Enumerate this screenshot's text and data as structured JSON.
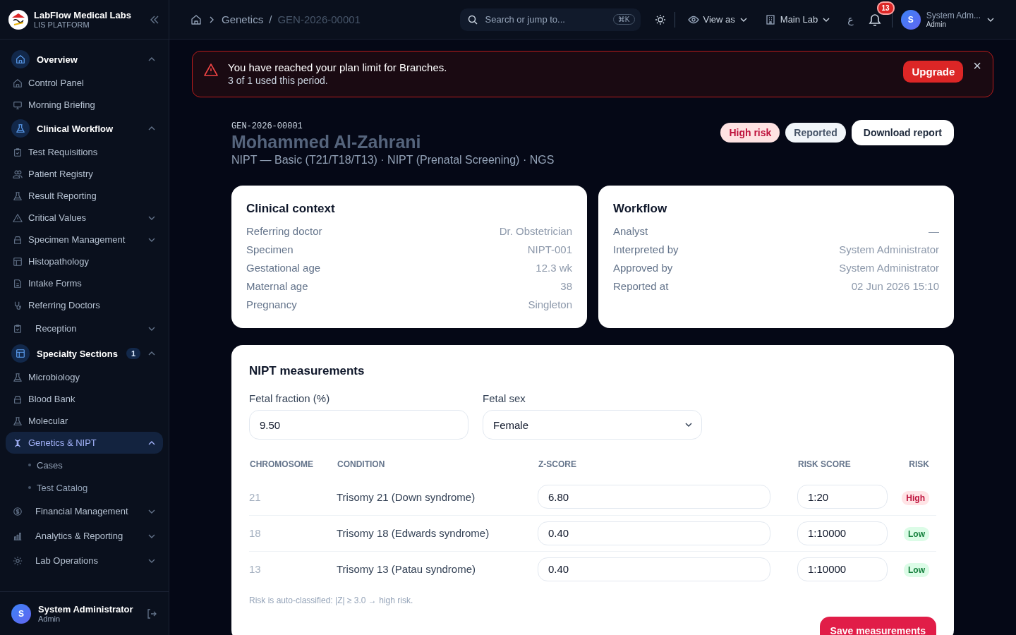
{
  "brand": {
    "name": "LabFlow Medical Labs",
    "subtitle": "LIS PLATFORM"
  },
  "sidebar": {
    "items": [
      {
        "kind": "group",
        "label": "Overview",
        "expanded": true
      },
      {
        "kind": "item",
        "label": "Control Panel"
      },
      {
        "kind": "item",
        "label": "Morning Briefing"
      },
      {
        "kind": "group",
        "label": "Clinical Workflow",
        "expanded": true
      },
      {
        "kind": "item",
        "label": "Test Requisitions"
      },
      {
        "kind": "item",
        "label": "Patient Registry"
      },
      {
        "kind": "item",
        "label": "Result Reporting"
      },
      {
        "kind": "item",
        "label": "Critical Values",
        "expanded": false
      },
      {
        "kind": "item",
        "label": "Specimen Management",
        "expanded": false
      },
      {
        "kind": "item",
        "label": "Histopathology"
      },
      {
        "kind": "item",
        "label": "Intake Forms"
      },
      {
        "kind": "item",
        "label": "Referring Doctors"
      },
      {
        "kind": "section",
        "label": "Reception",
        "expanded": false
      },
      {
        "kind": "group",
        "label": "Specialty Sections",
        "badge": "1",
        "expanded": true
      },
      {
        "kind": "item",
        "label": "Microbiology"
      },
      {
        "kind": "item",
        "label": "Blood Bank"
      },
      {
        "kind": "item",
        "label": "Molecular"
      },
      {
        "kind": "item",
        "label": "Genetics & NIPT",
        "selected": true,
        "expanded": true,
        "children": [
          {
            "kind": "subitem",
            "label": "Cases"
          },
          {
            "kind": "subitem",
            "label": "Test Catalog"
          }
        ]
      },
      {
        "kind": "section",
        "label": "Financial Management",
        "expanded": false
      },
      {
        "kind": "section",
        "label": "Analytics & Reporting",
        "expanded": false
      },
      {
        "kind": "section",
        "label": "Lab Operations",
        "expanded": false
      }
    ]
  },
  "user": {
    "initial": "S",
    "name": "System Administrator",
    "role": "Admin"
  },
  "topbar": {
    "breadcrumb": [
      "Genetics",
      "GEN-2026-00001"
    ],
    "breadcrumb_separator": "/",
    "search": {
      "placeholder": "Search or jump to...",
      "shortcut": "⌘K"
    },
    "view_as": "View as",
    "lab": "Main Lab",
    "language": "ع",
    "notifications": "13",
    "user": {
      "initial": "S",
      "name": "System Adm...",
      "role": "Admin"
    }
  },
  "alert": {
    "title": "You have reached your plan limit for Branches.",
    "message": "3 of 1 used this period.",
    "action": "Upgrade",
    "close": "×"
  },
  "case": {
    "id": "GEN-2026-00001",
    "patient": "Mohammed Al-Zahrani",
    "subtitle": "NIPT — Basic (T21/T18/T13) · NIPT (Prenatal Screening) · NGS",
    "badges": [
      {
        "kind": "danger",
        "label": "High risk"
      },
      {
        "kind": "neutral",
        "label": "Reported"
      }
    ],
    "download": "Download report"
  },
  "cards": [
    {
      "title": "Clinical context",
      "rows": [
        {
          "label": "Referring doctor",
          "value": "Dr. Obstetrician"
        },
        {
          "label": "Specimen",
          "value": "NIPT-001"
        },
        {
          "label": "Gestational age",
          "value": "12.3 wk"
        },
        {
          "label": "Maternal age",
          "value": "38"
        },
        {
          "label": "Pregnancy",
          "value": "Singleton"
        }
      ]
    },
    {
      "title": "Workflow",
      "rows": [
        {
          "label": "Analyst",
          "value": "—"
        },
        {
          "label": "Interpreted by",
          "value": "System Administrator"
        },
        {
          "label": "Approved by",
          "value": "System Administrator"
        },
        {
          "label": "Reported at",
          "value": "02 Jun 2026 15:10"
        }
      ]
    }
  ],
  "measurements": {
    "title": "NIPT measurements",
    "fetal_fraction": {
      "label": "Fetal fraction (%)",
      "value": "9.50"
    },
    "fetal_sex": {
      "label": "Fetal sex",
      "value": "Female"
    },
    "table": {
      "columns": [
        "CHROMOSOME",
        "CONDITION",
        "Z-SCORE",
        "RISK SCORE",
        "RISK"
      ],
      "rows": [
        {
          "chromosome": "21",
          "condition": "Trisomy 21 (Down syndrome)",
          "z_score": "6.80",
          "risk_score": "1:20",
          "risk": {
            "kind": "high",
            "label": "High"
          }
        },
        {
          "chromosome": "18",
          "condition": "Trisomy 18 (Edwards syndrome)",
          "z_score": "0.40",
          "risk_score": "1:10000",
          "risk": {
            "kind": "low",
            "label": "Low"
          }
        },
        {
          "chromosome": "13",
          "condition": "Trisomy 13 (Patau syndrome)",
          "z_score": "0.40",
          "risk_score": "1:10000",
          "risk": {
            "kind": "low",
            "label": "Low"
          }
        }
      ]
    },
    "note": "Risk is auto-classified: |Z| ≥ 3.0 → high risk.",
    "save": "Save measurements"
  }
}
